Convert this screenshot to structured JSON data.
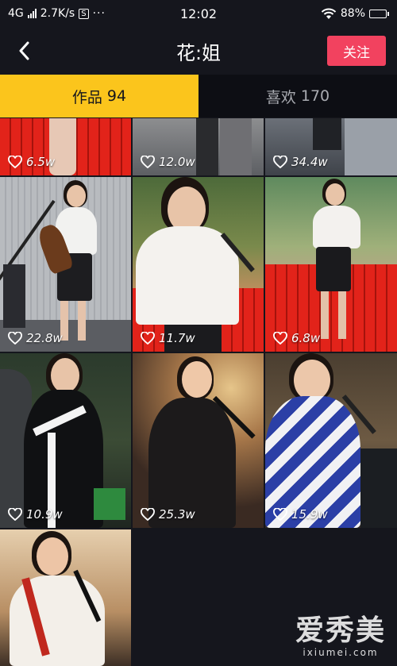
{
  "status_bar": {
    "network": "4G",
    "speed": "2.7K/s",
    "s_badge": "S",
    "dots": "···",
    "time": "12:02",
    "battery": "88%",
    "battery_level": 0.88
  },
  "nav": {
    "back_icon": "chevron-left-icon",
    "title": "花:姐",
    "follow_label": "关注"
  },
  "tabs": [
    {
      "label": "作品",
      "count": "94",
      "active": true
    },
    {
      "label": "喜欢",
      "count": "170",
      "active": false
    }
  ],
  "videos": [
    {
      "likes": "6.5w"
    },
    {
      "likes": "12.0w"
    },
    {
      "likes": "34.4w"
    },
    {
      "likes": "22.8w"
    },
    {
      "likes": "11.7w"
    },
    {
      "likes": "6.8w"
    },
    {
      "likes": "10.9w"
    },
    {
      "likes": "25.3w"
    },
    {
      "likes": "15.9w"
    },
    {
      "likes": ""
    }
  ],
  "watermark": {
    "main": "爱秀美",
    "sub": "ixiumei.com"
  },
  "colors": {
    "background": "#15161d",
    "active_tab": "#fbc51c",
    "follow_button": "#f2425f",
    "inactive_tab_text": "#a9abb1"
  }
}
